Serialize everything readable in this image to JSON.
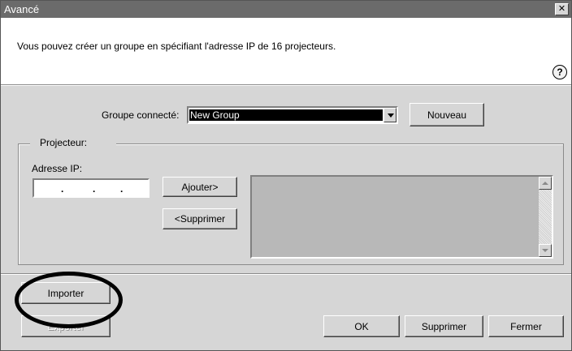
{
  "window": {
    "title": "Avancé",
    "close_glyph": "✕"
  },
  "info": {
    "message": "Vous pouvez créer un groupe en spécifiant l'adresse IP de 16 projecteurs.",
    "help_glyph": "?"
  },
  "group": {
    "label": "Groupe connecté:",
    "selected": "New Group",
    "new_button": "Nouveau"
  },
  "projector": {
    "legend": "Projecteur:",
    "ip_label": "Adresse IP:",
    "ip_value": [
      "",
      "",
      "",
      ""
    ],
    "add_button": "Ajouter>",
    "remove_button": "<Supprimer",
    "list_items": []
  },
  "footer": {
    "import_button": "Importer",
    "export_button": "Exporter",
    "ok_button": "OK",
    "delete_button": "Supprimer",
    "close_button": "Fermer"
  },
  "annotation": {
    "highlight_target": "Importer",
    "color": "#000000"
  },
  "colors": {
    "titlebar": "#6b6b6b",
    "dialog_bg": "#d6d6d6",
    "info_bg": "#ffffff",
    "list_bg": "#b8b8b8"
  }
}
